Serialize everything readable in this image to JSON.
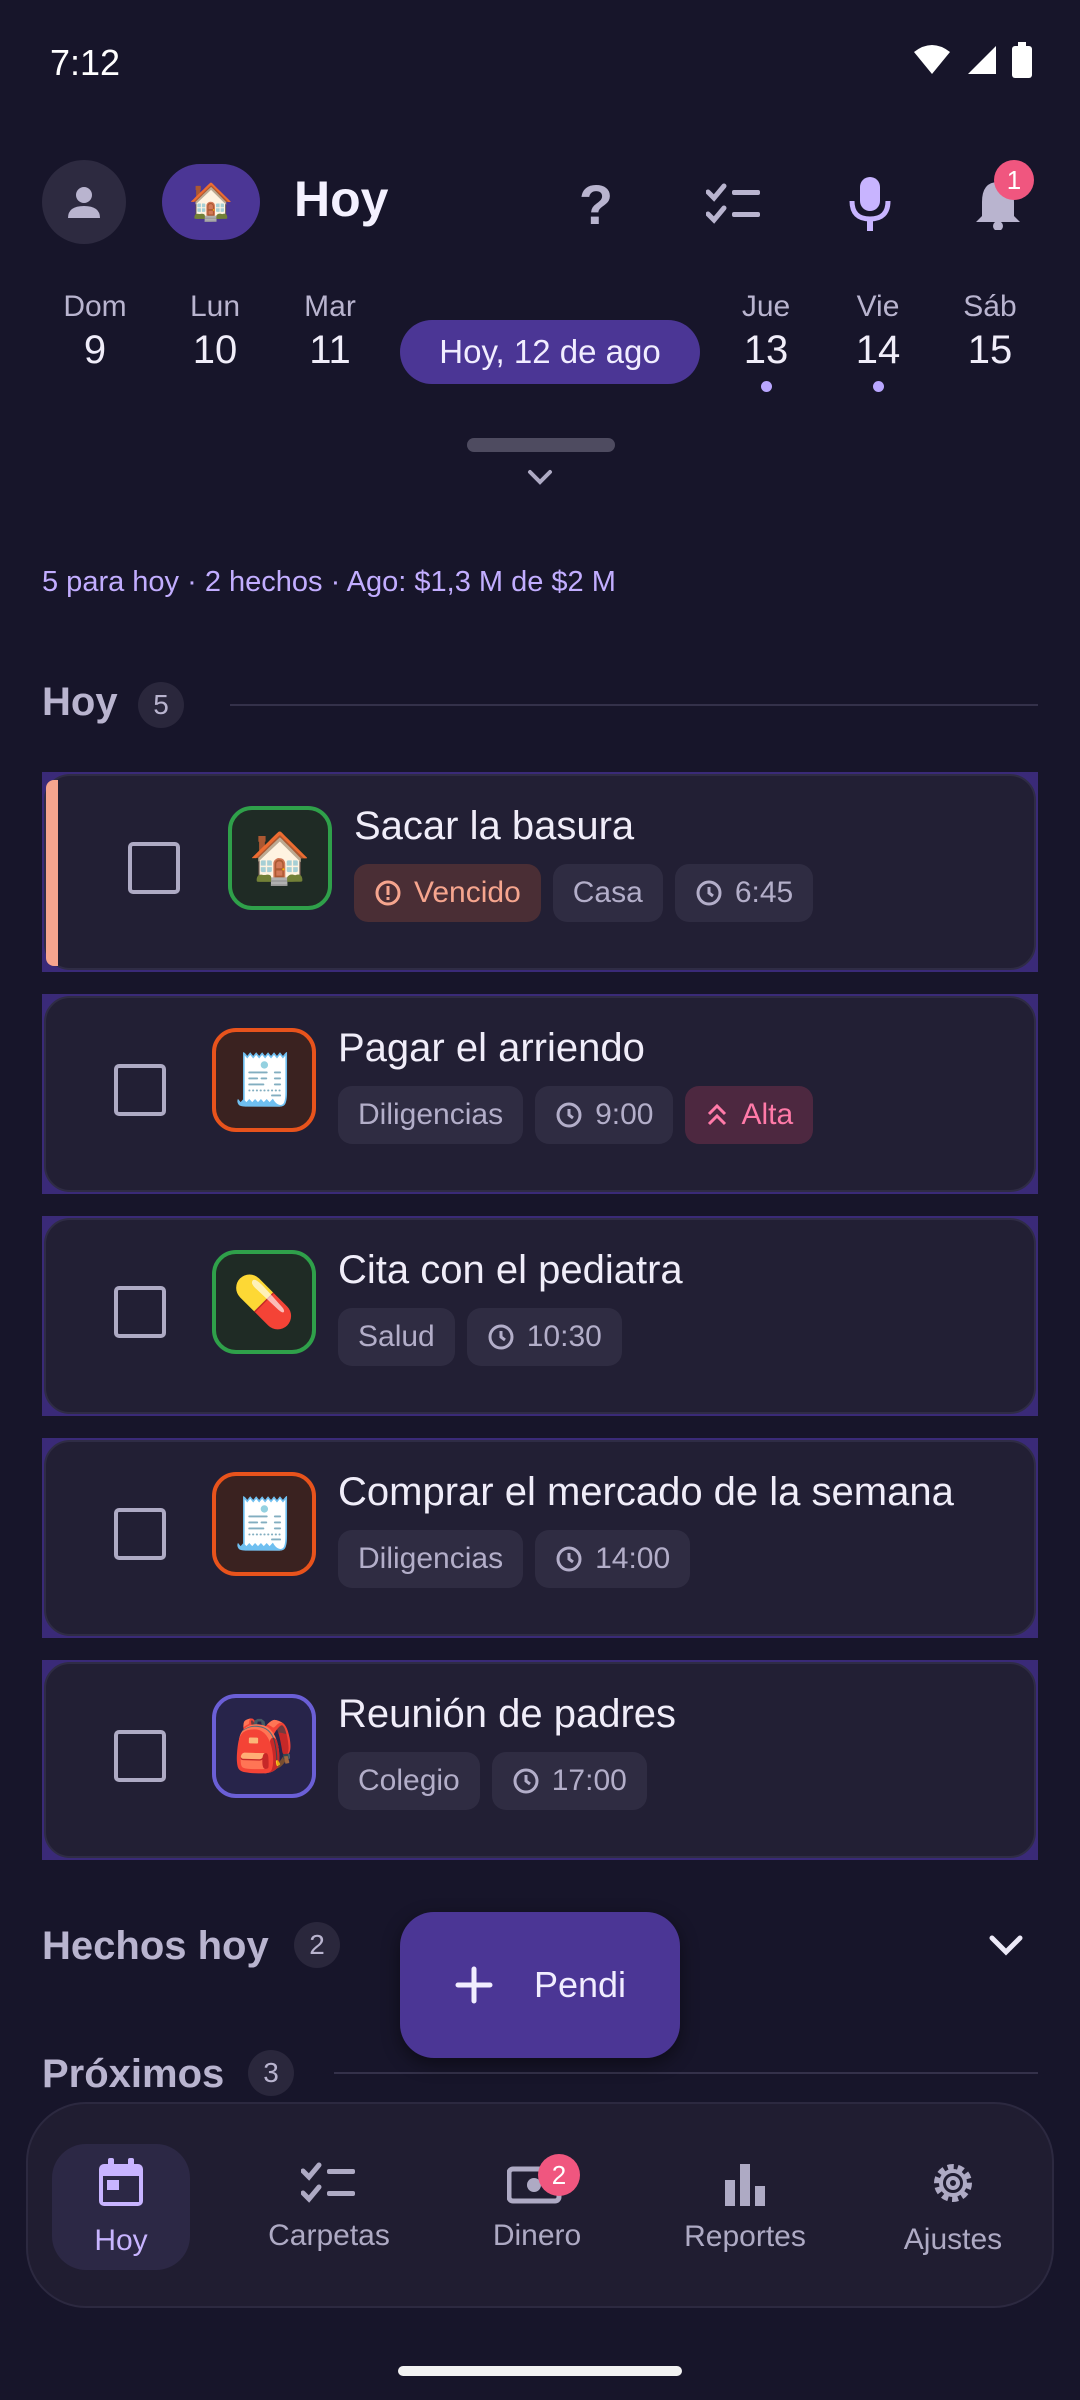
{
  "status_bar": {
    "time": "7:12"
  },
  "header": {
    "title": "Hoy",
    "home_icon": "🏠",
    "notification_count": "1"
  },
  "week": {
    "days": [
      {
        "name": "Dom",
        "num": "9"
      },
      {
        "name": "Lun",
        "num": "10"
      },
      {
        "name": "Mar",
        "num": "11"
      },
      {
        "name": "Jue",
        "num": "13"
      },
      {
        "name": "Vie",
        "num": "14"
      },
      {
        "name": "Sáb",
        "num": "15"
      }
    ],
    "today_label": "Hoy, 12 de ago"
  },
  "summary": "5 para hoy · 2 hechos · Ago: $1,3 M de $2 M",
  "sections": {
    "today": {
      "title": "Hoy",
      "count": "5"
    },
    "done": {
      "title": "Hechos hoy",
      "count": "2"
    },
    "upcoming": {
      "title": "Próximos",
      "count": "3"
    }
  },
  "tasks": [
    {
      "title": "Sacar la basura",
      "icon": "🏠",
      "overdue": "Vencido",
      "category": "Casa",
      "time": "6:45"
    },
    {
      "title": "Pagar el arriendo",
      "icon": "🧾",
      "category": "Diligencias",
      "time": "9:00",
      "priority": "Alta"
    },
    {
      "title": "Cita con el pediatra",
      "icon": "💊",
      "category": "Salud",
      "time": "10:30"
    },
    {
      "title": "Comprar el mercado de la semana",
      "icon": "🧾",
      "category": "Diligencias",
      "time": "14:00"
    },
    {
      "title": "Reunión de padres",
      "icon": "🎒",
      "category": "Colegio",
      "time": "17:00"
    }
  ],
  "fab": {
    "label": "Pendi"
  },
  "nav": {
    "items": [
      {
        "label": "Hoy"
      },
      {
        "label": "Carpetas"
      },
      {
        "label": "Dinero",
        "badge": "2"
      },
      {
        "label": "Reportes"
      },
      {
        "label": "Ajustes"
      }
    ]
  },
  "colors": {
    "accent": "#4b3695",
    "background": "#17152a",
    "overdue": "#f6a58e",
    "high_priority": "#ff7aa8"
  }
}
